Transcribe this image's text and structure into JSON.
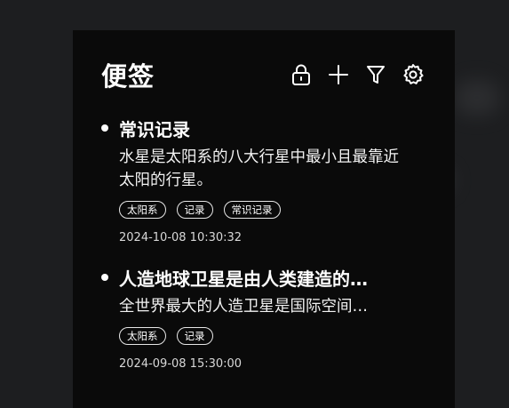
{
  "app": {
    "title": "便签"
  },
  "header": {
    "icons": [
      "lock-icon",
      "plus-icon",
      "filter-icon",
      "gear-icon"
    ]
  },
  "notes": [
    {
      "title": "常识记录",
      "body": "水星是太阳系的八大行星中最小且最靠近太阳的行星。",
      "tags": [
        "太阳系",
        "记录",
        "常识记录"
      ],
      "timestamp": "2024-10-08 10:30:32"
    },
    {
      "title": "人造地球卫星是由人类建造的…",
      "body": "全世界最大的人造卫星是国际空间…",
      "tags": [
        "太阳系",
        "记录"
      ],
      "timestamp": "2024-09-08 15:30:00"
    }
  ],
  "colors": {
    "background": "#1d1e20",
    "panel": "#0a0a0a",
    "text": "#ffffff"
  }
}
